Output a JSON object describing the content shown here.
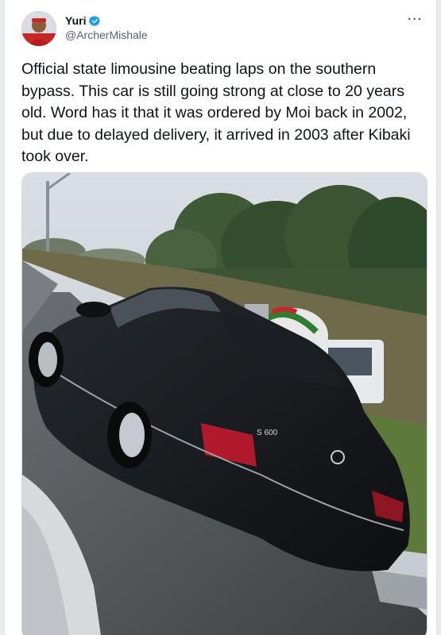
{
  "tweet": {
    "display_name": "Yuri",
    "handle": "@ArcherMishale",
    "verified": true,
    "more_label": "···",
    "text": "Official state limousine beating laps on the southern bypass. This car is still going strong at close to 20 years old. Word has it that it was ordered by Moi back in 2002, but due to delayed delivery, it arrived in 2003 after Kibaki took over.",
    "media_badge": "S 600"
  },
  "icons": {
    "verified": "verified-badge-icon",
    "more": "more-options-icon"
  },
  "colors": {
    "verified": "#1d9bf0",
    "handle": "#536471",
    "text": "#0f1419"
  }
}
